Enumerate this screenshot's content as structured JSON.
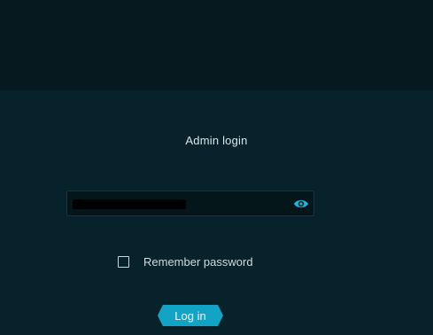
{
  "login": {
    "title": "Admin login",
    "password_value": "",
    "password_masked": true,
    "remember_label": "Remember password",
    "remember_checked": false,
    "submit_label": "Log in"
  },
  "icons": {
    "password_toggle": "eye-icon"
  },
  "colors": {
    "background": "#041a1f",
    "panel": "#07222a",
    "accent": "#13a3c4",
    "text": "#d9e6e8"
  }
}
